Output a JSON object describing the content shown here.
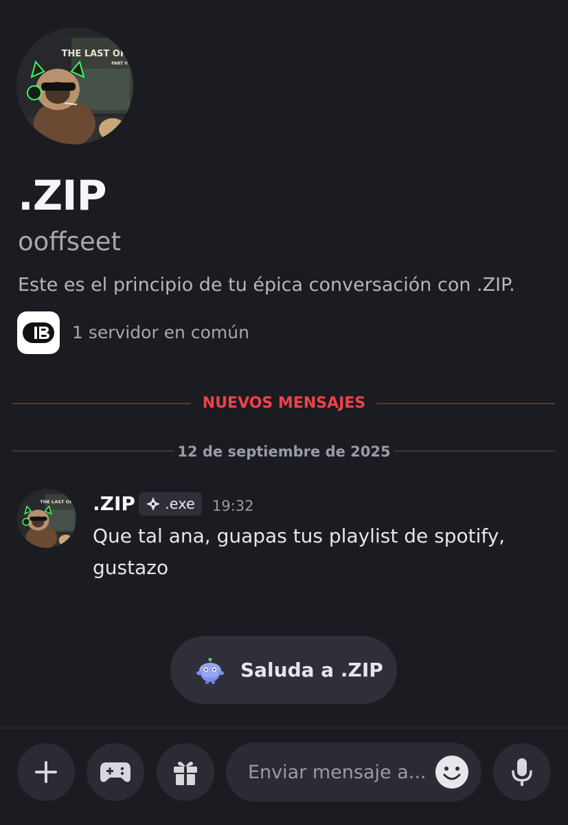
{
  "profile": {
    "display_name": ".ZIP",
    "username": "ooffseet",
    "intro": "Este es el principio de tu épica conversación con .ZIP.",
    "avatar_text_top": "THE LAST OF US",
    "avatar_text_bottom": "PART II",
    "mutual_servers": "1 servidor en común",
    "server_icon": "server-logo-icon"
  },
  "dividers": {
    "new_messages": "NUEVOS MENSAJES",
    "date": "12 de septiembre de 2025"
  },
  "message": {
    "author": ".ZIP",
    "tag": ".exe",
    "time": "19:32",
    "text": "Que tal ana, guapas tus playlist de spotify, gustazo"
  },
  "wave": {
    "label": "Saluda a .ZIP",
    "icon": "wumpus-icon"
  },
  "composer": {
    "placeholder": "Enviar mensaje a...",
    "buttons": [
      "plus-icon",
      "gamepad-icon",
      "gift-icon",
      "emoji-icon",
      "microphone-icon"
    ]
  },
  "colors": {
    "background": "#1b1c21",
    "new_messages": "#f2414b",
    "surface": "#2b2c33"
  }
}
